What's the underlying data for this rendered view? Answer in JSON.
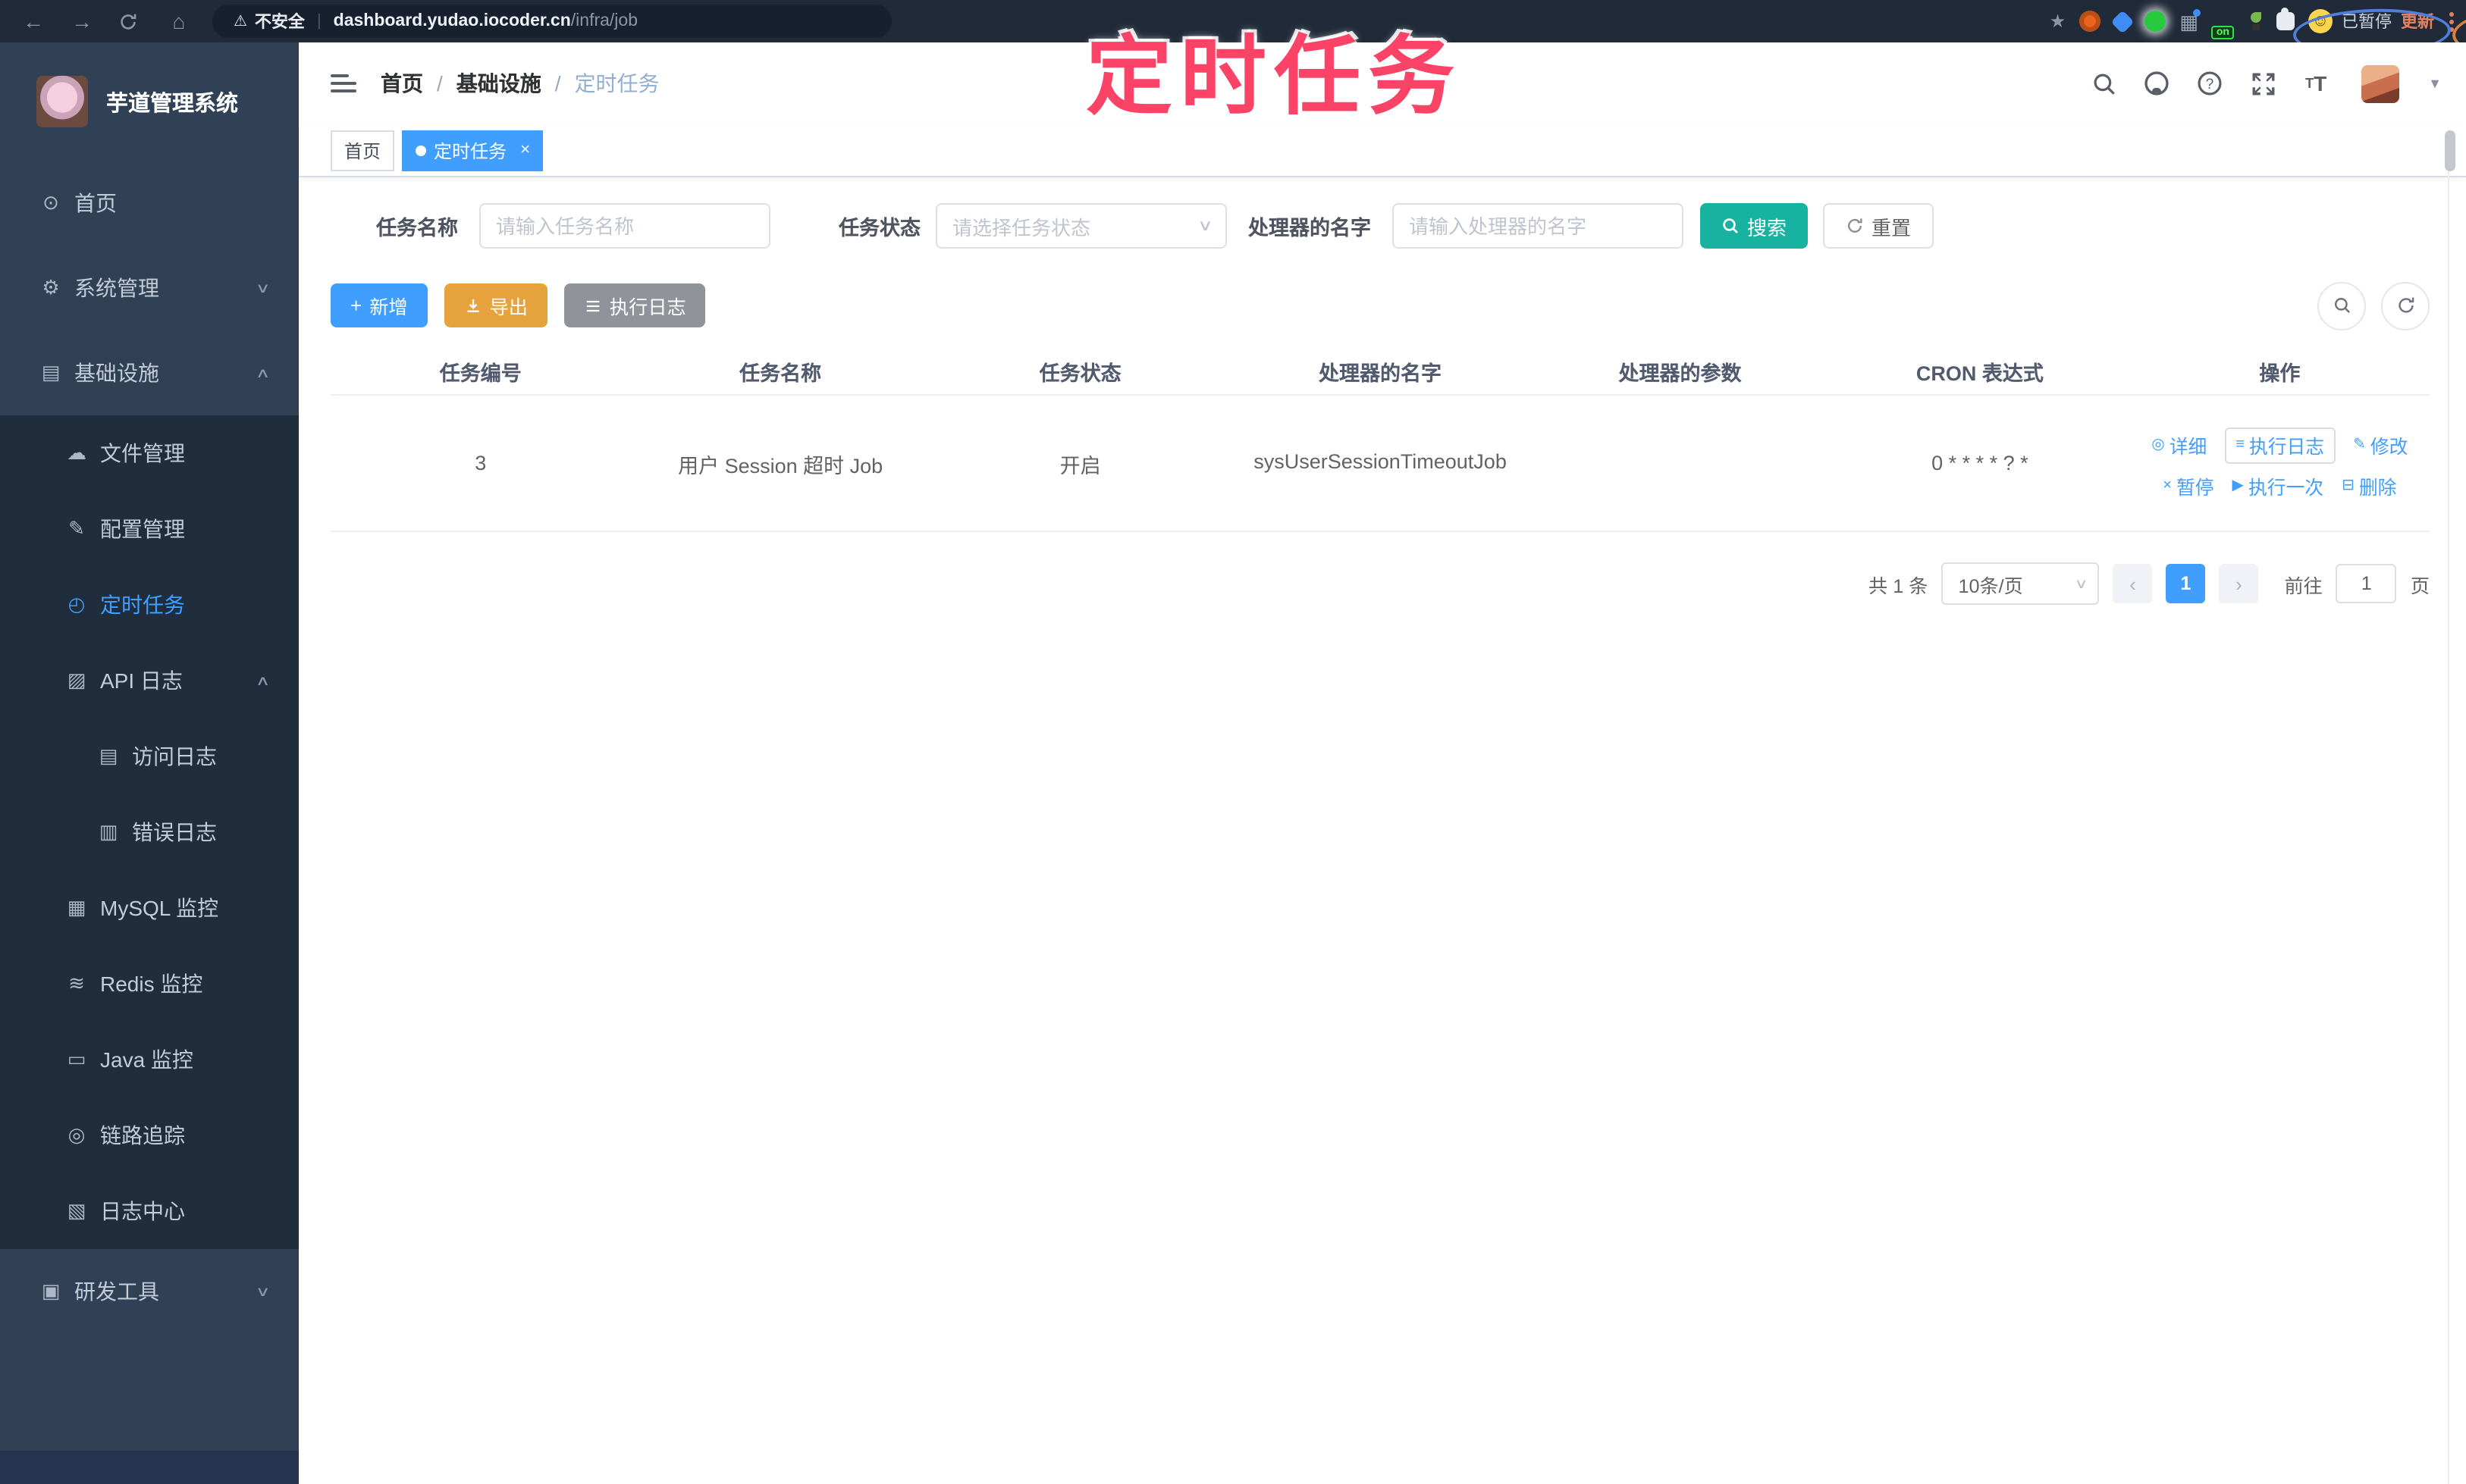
{
  "browser": {
    "warning_label": "不安全",
    "divider": "|",
    "host": "dashboard.yudao.iocoder.cn",
    "path": "/infra/job",
    "on_badge": "on",
    "paused_badge": "已暂停",
    "update_button": "更新"
  },
  "overlay": {
    "title": "定时任务"
  },
  "sidebar": {
    "app_title": "芋道管理系统",
    "items": [
      {
        "label": "首页"
      },
      {
        "label": "系统管理"
      },
      {
        "label": "基础设施"
      },
      {
        "label": "文件管理"
      },
      {
        "label": "配置管理"
      },
      {
        "label": "定时任务"
      },
      {
        "label": "API 日志"
      },
      {
        "label": "访问日志"
      },
      {
        "label": "错误日志"
      },
      {
        "label": "MySQL 监控"
      },
      {
        "label": "Redis 监控"
      },
      {
        "label": "Java 监控"
      },
      {
        "label": "链路追踪"
      },
      {
        "label": "日志中心"
      },
      {
        "label": "研发工具"
      }
    ]
  },
  "header": {
    "breadcrumb": [
      "首页",
      "基础设施",
      "定时任务"
    ],
    "separator": "/"
  },
  "tabs": [
    {
      "label": "首页"
    },
    {
      "label": "定时任务",
      "close": "×"
    }
  ],
  "filters": {
    "name_label": "任务名称",
    "name_placeholder": "请输入任务名称",
    "status_label": "任务状态",
    "status_placeholder": "请选择任务状态",
    "handler_label": "处理器的名字",
    "handler_placeholder": "请输入处理器的名字",
    "search_label": "搜索",
    "reset_label": "重置"
  },
  "toolbar": {
    "add_label": "新增",
    "export_label": "导出",
    "exec_log_label": "执行日志"
  },
  "table": {
    "columns": [
      "任务编号",
      "任务名称",
      "任务状态",
      "处理器的名字",
      "处理器的参数",
      "CRON 表达式",
      "操作"
    ],
    "rows": [
      {
        "id": "3",
        "name": "用户 Session 超时 Job",
        "status": "开启",
        "handler": "sysUserSessionTimeoutJob",
        "params": "",
        "cron": "0 * * * * ? *",
        "actions": [
          "详细",
          "执行日志",
          "修改",
          "暂停",
          "执行一次",
          "删除"
        ]
      }
    ]
  },
  "pagination": {
    "total": "共 1 条",
    "page_size": "10条/页",
    "current_page": "1",
    "goto_label": "前往",
    "goto_value": "1",
    "page_unit": "页"
  },
  "colors": {
    "accent": "#409EFF",
    "search_teal": "#18b3a0",
    "warning": "#E6A23C",
    "info_gray": "#909399",
    "sidebar_bg": "#304156",
    "submenu_bg": "#1f2d3d",
    "overlay_pink": "#fb4368"
  }
}
